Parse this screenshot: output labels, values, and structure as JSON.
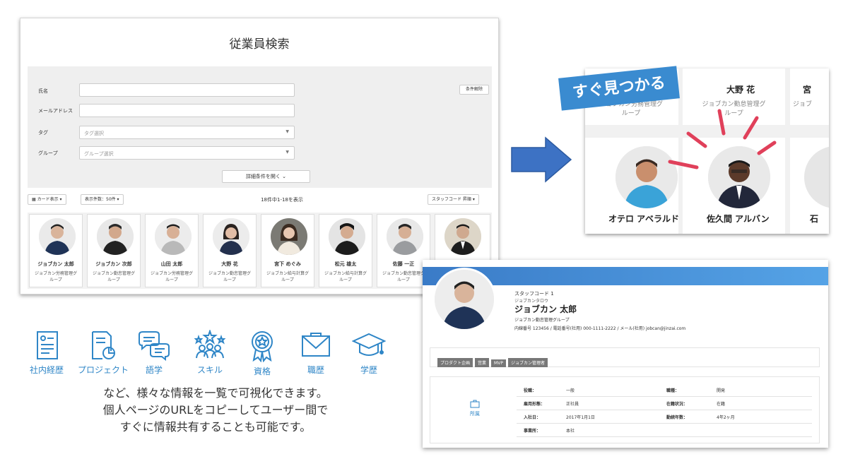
{
  "search": {
    "title": "従業員検索",
    "fields": {
      "name_label": "氏名",
      "email_label": "メールアドレス",
      "tag_label": "タグ",
      "tag_placeholder": "タグ選択",
      "group_label": "グループ",
      "group_placeholder": "グループ選択"
    },
    "clear_button": "条件解除",
    "detail_button": "詳細条件を開く",
    "toolbar": {
      "view_mode": "カード表示",
      "per_page": "表示件数：50件",
      "result_count": "18件中1-18を表示",
      "sort": "スタッフコード 昇順"
    },
    "cards": [
      {
        "name": "ジョブカン 太郎",
        "group1": "ジョブカン労務管理グ",
        "group2": "ループ"
      },
      {
        "name": "ジョブカン 次郎",
        "group1": "ジョブカン勤怠管理グ",
        "group2": "ループ"
      },
      {
        "name": "山田 太郎",
        "group1": "ジョブカン労務管理グ",
        "group2": "ループ"
      },
      {
        "name": "大野 花",
        "group1": "ジョブカン勤怠管理グ",
        "group2": "ループ"
      },
      {
        "name": "宮下 めぐみ",
        "group1": "ジョブカン給与計算グ",
        "group2": "ループ"
      },
      {
        "name": "松元 雄太",
        "group1": "ジョブカン給与計算グ",
        "group2": "ループ"
      },
      {
        "name": "佐藤 一正",
        "group1": "ジョブカン勤怠管理グ",
        "group2": "ループ"
      }
    ]
  },
  "zoom": {
    "badge": "すぐ見つかる",
    "top_name": "大野 花",
    "top_group_left": "ジョブカン労務管理グ",
    "top_group_left2": "ループ",
    "top_group_mid": "ジョブカン勤怠管理グ",
    "top_group_mid2": "ループ",
    "top_right_name": "宮",
    "top_right_group": "ジョブ",
    "bottom_left_name": "オテロ アベラルド",
    "bottom_mid_name": "佐久間 アルバン",
    "bottom_right_name": "石"
  },
  "profile": {
    "staff_code": "スタッフコード 1",
    "kana": "ジョブカンタロウ",
    "name": "ジョブカン 太郎",
    "group": "ジョブカン勤怠管理グループ",
    "contact": "内線番号 123456 / 電話番号(社用) 000-1111-2222 / メール(社用) jobcan@jinzai.com",
    "tags": [
      "プロダクト企画",
      "営業",
      "MVP",
      "ジョブカン管理者"
    ],
    "section_label": "所属",
    "details": [
      {
        "l1": "役職：",
        "v1": "一般",
        "l2": "職種：",
        "v2": "開発"
      },
      {
        "l1": "雇用形態：",
        "v1": "正社員",
        "l2": "在籍状況：",
        "v2": "在籍"
      },
      {
        "l1": "入社日：",
        "v1": "2017年1月1日",
        "l2": "勤続年数：",
        "v2": "4年2ヶ月"
      },
      {
        "l1": "事業所：",
        "v1": "本社",
        "l2": "",
        "v2": ""
      }
    ]
  },
  "features": [
    "社内経歴",
    "プロジェクト",
    "語学",
    "スキル",
    "資格",
    "職歴",
    "学歴"
  ],
  "caption": {
    "line1": "など、様々な情報を一覧で可視化できます。",
    "line2": "個人ページのURLをコピーしてユーザー間で",
    "line3": "すぐに情報共有することも可能です。"
  },
  "colors": {
    "accent": "#2f86c7",
    "arrow": "#3d72c4",
    "badge": "#3a8bd0",
    "highlight": "#e0405a"
  }
}
